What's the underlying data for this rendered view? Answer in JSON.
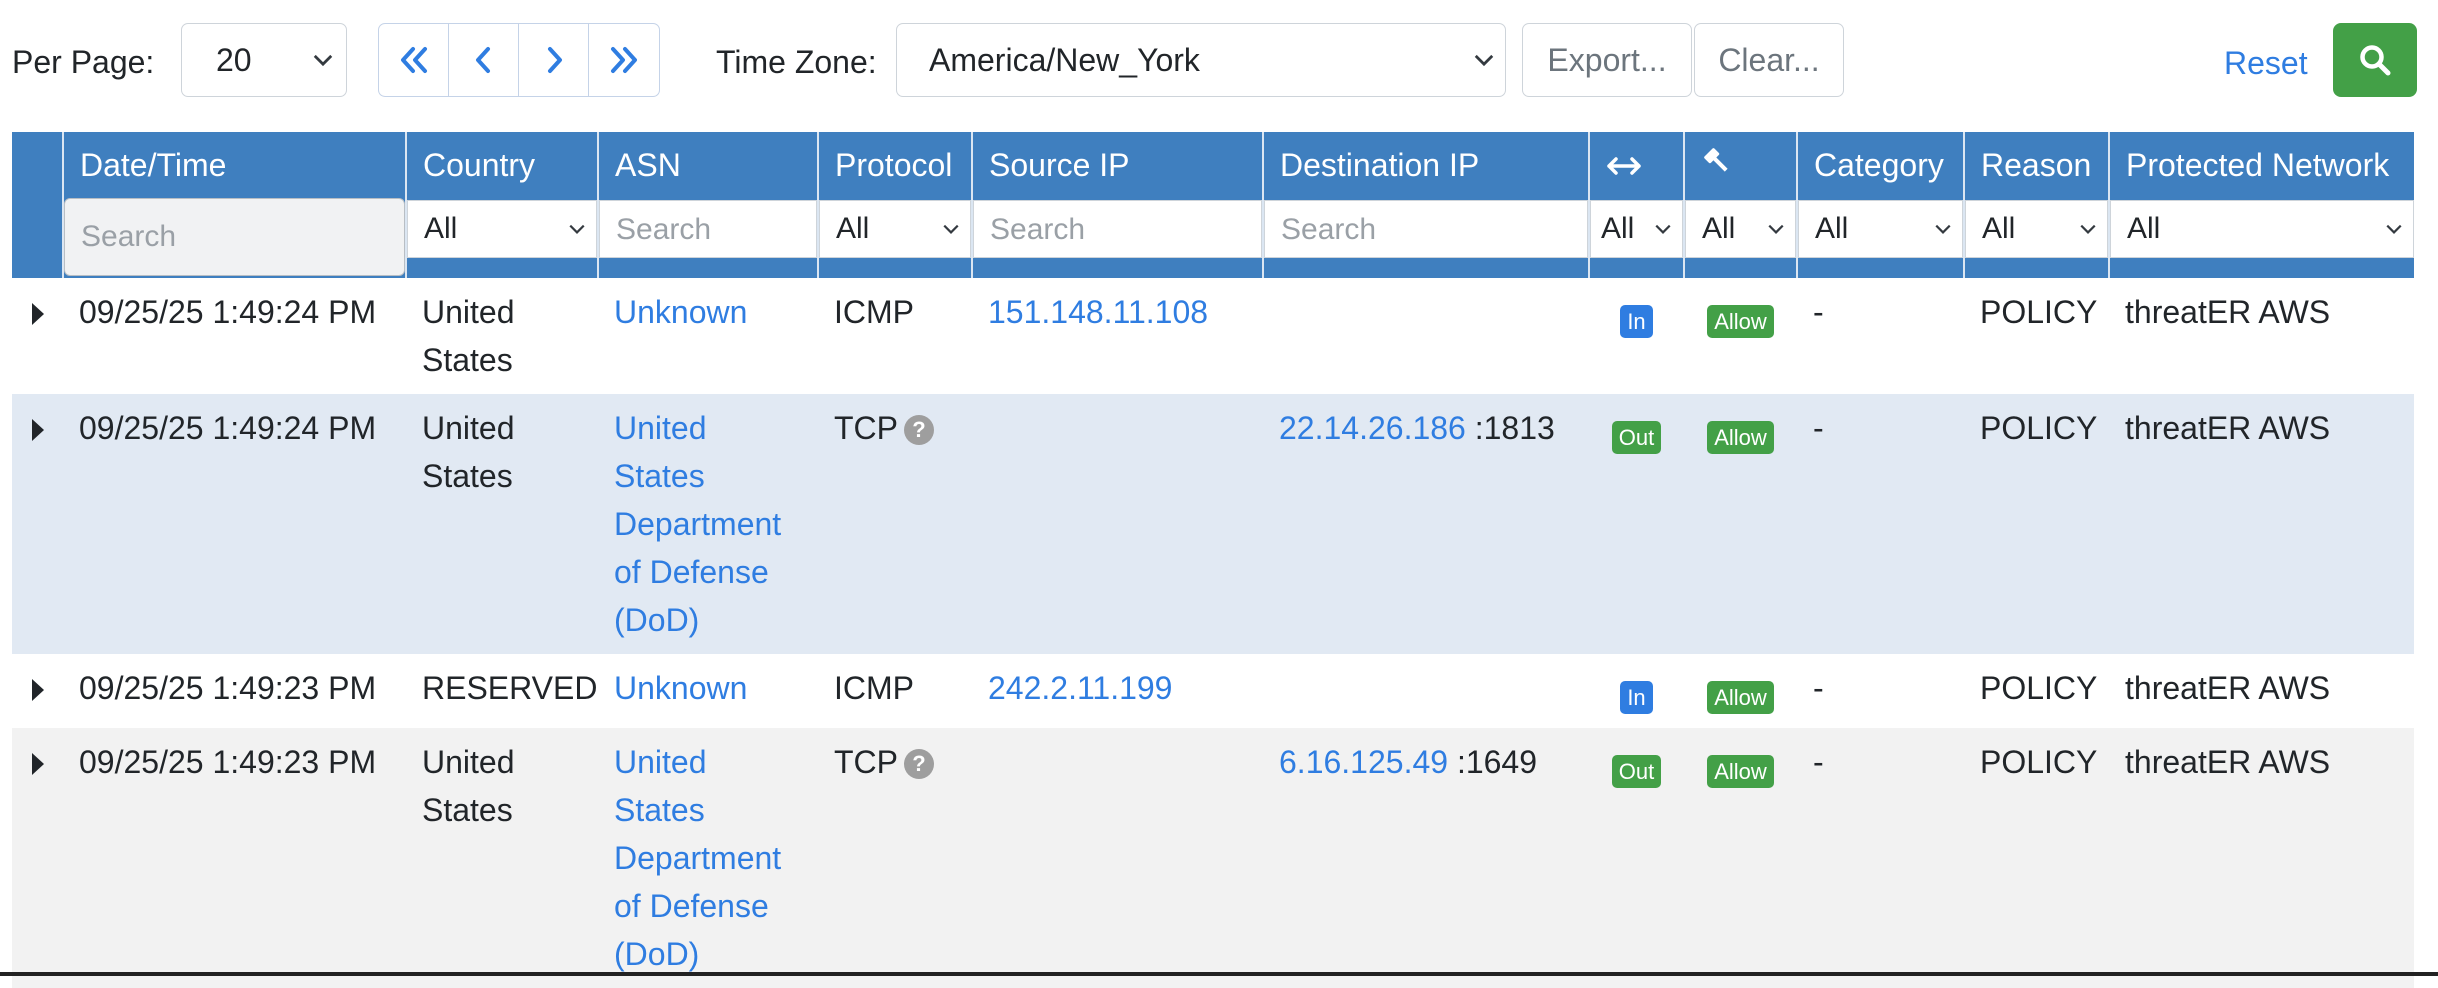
{
  "toolbar": {
    "per_page_label": "Per Page:",
    "per_page_value": "20",
    "timezone_label": "Time Zone:",
    "timezone_value": "America/New_York",
    "export_label": "Export...",
    "clear_label": "Clear...",
    "reset_label": "Reset"
  },
  "columns": {
    "datetime": "Date/Time",
    "country": "Country",
    "asn": "ASN",
    "protocol": "Protocol",
    "source_ip": "Source IP",
    "destination_ip": "Destination IP",
    "direction_icon": "left-right-arrow-icon",
    "action_icon": "gavel-icon",
    "category": "Category",
    "reason": "Reason",
    "protected_network": "Protected Network"
  },
  "filters": {
    "datetime_placeholder": "Search",
    "country": "All",
    "asn_placeholder": "Search",
    "protocol": "All",
    "source_ip_placeholder": "Search",
    "destination_ip_placeholder": "Search",
    "direction": "All",
    "action": "All",
    "category": "All",
    "reason": "All",
    "protected_network": "All"
  },
  "rows": [
    {
      "datetime": "09/25/25 1:49:24 PM",
      "country": "United States",
      "asn": "Unknown",
      "protocol": "ICMP",
      "source_ip": "151.148.11.108",
      "destination_ip": "",
      "destination_port": "",
      "direction": "In",
      "action": "Allow",
      "category": "-",
      "reason": "POLICY",
      "protected_network": "threatER AWS"
    },
    {
      "datetime": "09/25/25 1:49:24 PM",
      "country": "United States",
      "asn": "United States Department of Defense (DoD)",
      "protocol": "TCP",
      "source_ip": "",
      "destination_ip": "22.14.26.186",
      "destination_port": ":1813",
      "direction": "Out",
      "action": "Allow",
      "category": "-",
      "reason": "POLICY",
      "protected_network": "threatER AWS"
    },
    {
      "datetime": "09/25/25 1:49:23 PM",
      "country": "RESERVED",
      "asn": "Unknown",
      "protocol": "ICMP",
      "source_ip": "242.2.11.199",
      "destination_ip": "",
      "destination_port": "",
      "direction": "In",
      "action": "Allow",
      "category": "-",
      "reason": "POLICY",
      "protected_network": "threatER AWS"
    },
    {
      "datetime": "09/25/25 1:49:23 PM",
      "country": "United States",
      "asn": "United States Department of Defense (DoD)",
      "protocol": "TCP",
      "source_ip": "",
      "destination_ip": "6.16.125.49",
      "destination_port": ":1649",
      "direction": "Out",
      "action": "Allow",
      "category": "-",
      "reason": "POLICY",
      "protected_network": "threatER AWS"
    }
  ],
  "colors": {
    "header_blue": "#3f7fbf",
    "link_blue": "#2f7de1",
    "green": "#43a047",
    "row_blue": "#e1e9f3",
    "row_gray": "#f2f2f2"
  }
}
